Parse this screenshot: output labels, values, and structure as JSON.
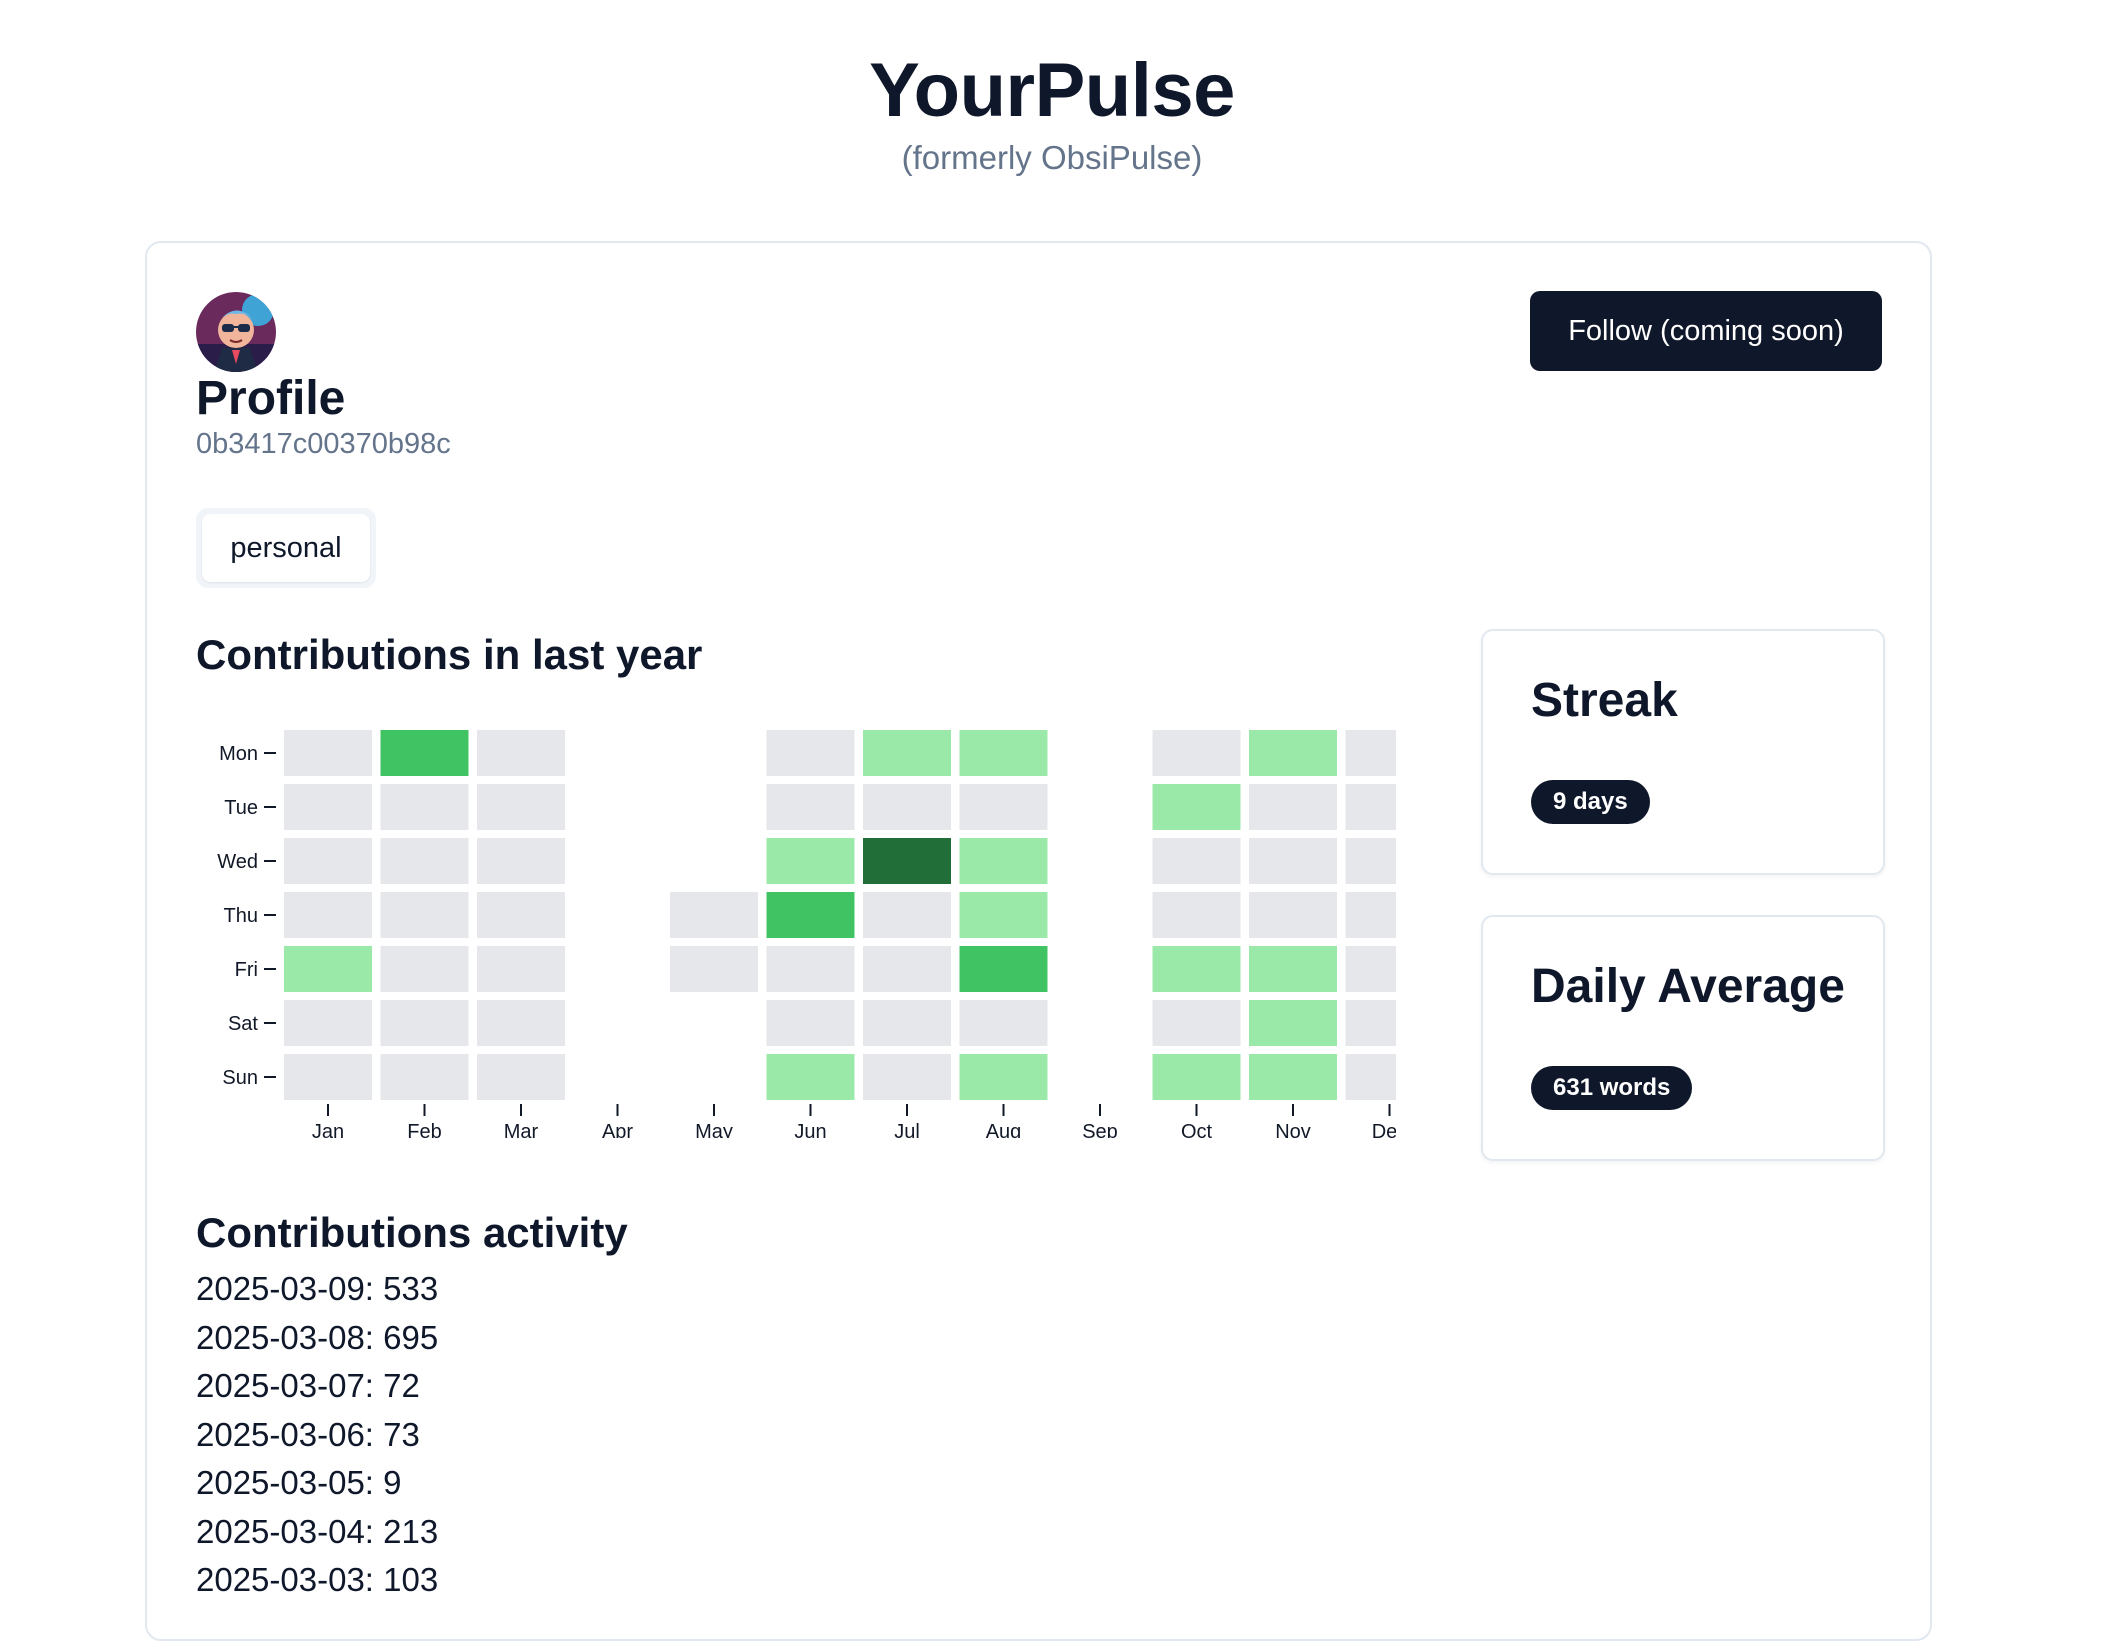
{
  "site": {
    "title": "YourPulse",
    "subtitle": "(formerly ObsiPulse)"
  },
  "profile": {
    "name": "Profile",
    "id": "0b3417c00370b98c",
    "follow_label": "Follow (coming soon)",
    "tag": "personal"
  },
  "heatmap": {
    "title": "Contributions in last year"
  },
  "stats": {
    "streak_title": "Streak",
    "streak_value": "9 days",
    "avg_title": "Daily Average",
    "avg_value": "631 words"
  },
  "activity": {
    "title": "Contributions activity",
    "items": [
      "2025-03-09: 533",
      "2025-03-08: 695",
      "2025-03-07: 72",
      "2025-03-06: 73",
      "2025-03-05: 9",
      "2025-03-04: 213",
      "2025-03-03: 103"
    ]
  },
  "colors": {
    "empty": "#e5e7eb",
    "level_1": "#9be9a8",
    "level_2": "#40c463",
    "level_3": "#216e39",
    "accent": "#0f172a",
    "muted": "#64748b"
  },
  "chart_data": {
    "type": "heatmap",
    "title": "Contributions in last year",
    "x_categories": [
      "Jan",
      "Feb",
      "Mar",
      "Apr",
      "May",
      "Jun",
      "Jul",
      "Aug",
      "Sep",
      "Oct",
      "Nov",
      "Dec"
    ],
    "y_categories": [
      "Mon",
      "Tue",
      "Wed",
      "Thu",
      "Fri",
      "Sat",
      "Sun"
    ],
    "levels": [
      [
        0,
        2,
        0,
        null,
        null,
        0,
        1,
        1,
        null,
        0,
        1,
        0
      ],
      [
        0,
        0,
        0,
        null,
        null,
        0,
        0,
        0,
        null,
        1,
        0,
        0
      ],
      [
        0,
        0,
        0,
        null,
        null,
        1,
        3,
        1,
        null,
        0,
        0,
        0
      ],
      [
        0,
        0,
        0,
        null,
        0,
        2,
        0,
        1,
        null,
        0,
        0,
        0
      ],
      [
        1,
        0,
        0,
        null,
        0,
        0,
        0,
        2,
        null,
        1,
        1,
        0
      ],
      [
        0,
        0,
        0,
        null,
        null,
        0,
        0,
        0,
        null,
        0,
        1,
        0
      ],
      [
        0,
        0,
        0,
        null,
        null,
        1,
        0,
        1,
        null,
        1,
        1,
        0
      ]
    ]
  }
}
